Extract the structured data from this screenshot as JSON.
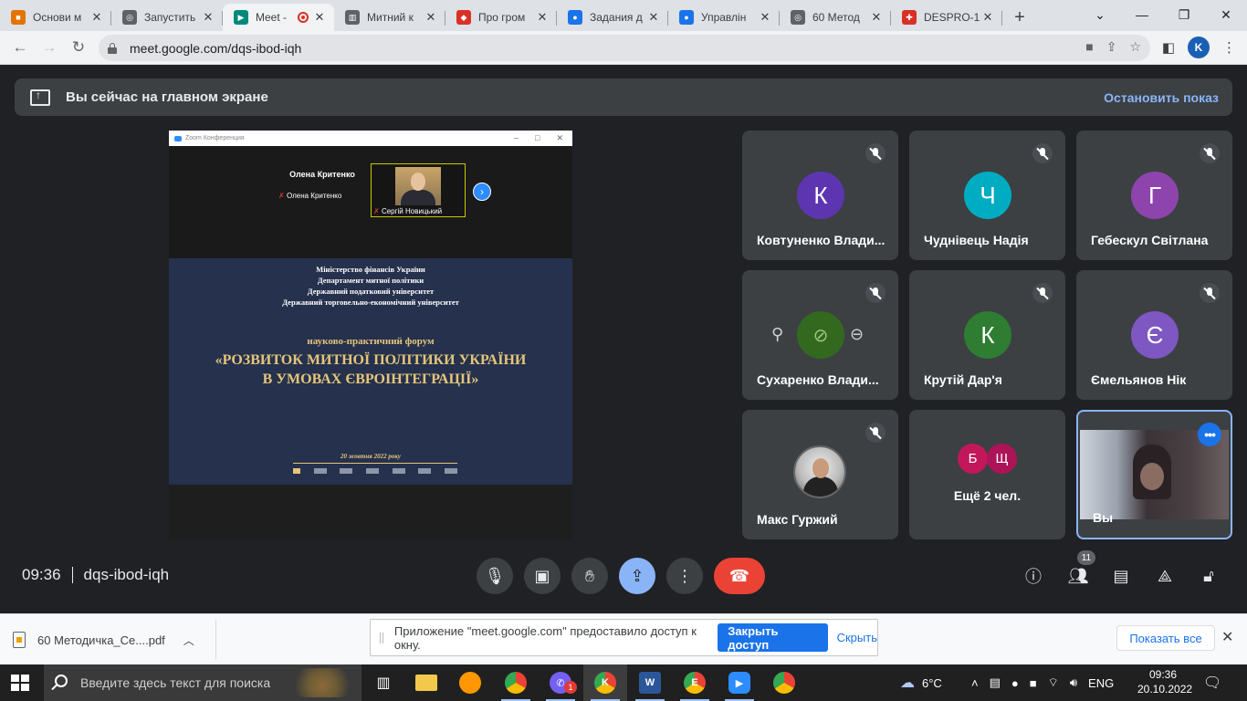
{
  "browser": {
    "tabs": [
      {
        "label": "Основи м",
        "fav_color": "#e37400",
        "fav_glyph": "■"
      },
      {
        "label": "Запустить",
        "fav_color": "#5f6368",
        "fav_glyph": "◎"
      },
      {
        "label": "Meet -",
        "fav_color": "#00897b",
        "fav_glyph": "▶",
        "active": true
      },
      {
        "label": "Митний к",
        "fav_color": "#5f6368",
        "fav_glyph": "▥"
      },
      {
        "label": "Про гром",
        "fav_color": "#d93025",
        "fav_glyph": "◆"
      },
      {
        "label": "Задания д",
        "fav_color": "#1a73e8",
        "fav_glyph": "●"
      },
      {
        "label": "Управлін",
        "fav_color": "#1a73e8",
        "fav_glyph": "●"
      },
      {
        "label": "60 Метод",
        "fav_color": "#5f6368",
        "fav_glyph": "◎"
      },
      {
        "label": "DESPRO-1",
        "fav_color": "#d93025",
        "fav_glyph": "✚"
      }
    ],
    "new_tab": "+",
    "url": "meet.google.com/dqs-ibod-iqh",
    "profile_initial": "K"
  },
  "meet": {
    "present_banner": {
      "text": "Вы сейчас на главном экране",
      "stop_label": "Остановить показ"
    },
    "shared_screen": {
      "window_title": "Zoom Конференция",
      "gallery": [
        {
          "big_name": "Олена Критенко",
          "caption": "Олена Критенко"
        },
        {
          "caption": "Сергій Новицький"
        }
      ],
      "slide": {
        "institutions": [
          "Міністерство фінансів України",
          "Департамент митної політики",
          "Державний податковий університет",
          "Державний торговельно-економічний університет"
        ],
        "forum_label": "науково-практичний форум",
        "title_line1": "«РОЗВИТОК МИТНОЇ ПОЛІТИКИ УКРАЇНИ",
        "title_line2": "В УМОВАХ ЄВРОІНТЕГРАЦІЇ»",
        "date": "20 жовтня 2022 року"
      }
    },
    "participants": [
      {
        "initial": "К",
        "name": "Ковтуненко Влади...",
        "color": "#5e35b1"
      },
      {
        "initial": "Ч",
        "name": "Чуднівець Надія",
        "color": "#00acc1"
      },
      {
        "initial": "Г",
        "name": "Гебескул Світлана",
        "color": "#8e44ad"
      },
      {
        "name": "Сухаренко Влади...",
        "color": "#33691e"
      },
      {
        "initial": "К",
        "name": "Крутій Дар'я",
        "color": "#2e7d32"
      },
      {
        "initial": "Є",
        "name": "Ємельянов Нік",
        "color": "#7e57c2"
      },
      {
        "name": "Макс Гуржий"
      }
    ],
    "more_tile": {
      "initials": [
        "Б",
        "Щ"
      ],
      "colors": [
        "#c2185b",
        "#ad1457"
      ],
      "text": "Ещё 2 чел."
    },
    "self_tile": {
      "name": "Вы",
      "menu": "•••"
    },
    "footer": {
      "time": "09:36",
      "meeting_code": "dqs-ibod-iqh",
      "participants_count": "11"
    }
  },
  "downloads": {
    "file": "60 Методичка_Се....pdf",
    "notice_text": "Приложение \"meet.google.com\" предоставило доступ к окну.",
    "stop_share": "Закрыть доступ",
    "hide": "Скрыть",
    "show_all": "Показать все"
  },
  "taskbar": {
    "search_placeholder": "Введите здесь текст для поиска",
    "weather": "6°C",
    "language": "ENG",
    "time": "09:36",
    "date": "20.10.2022",
    "viber_badge": "1",
    "chrome_profile_k": "K",
    "chrome_profile_e": "E"
  }
}
